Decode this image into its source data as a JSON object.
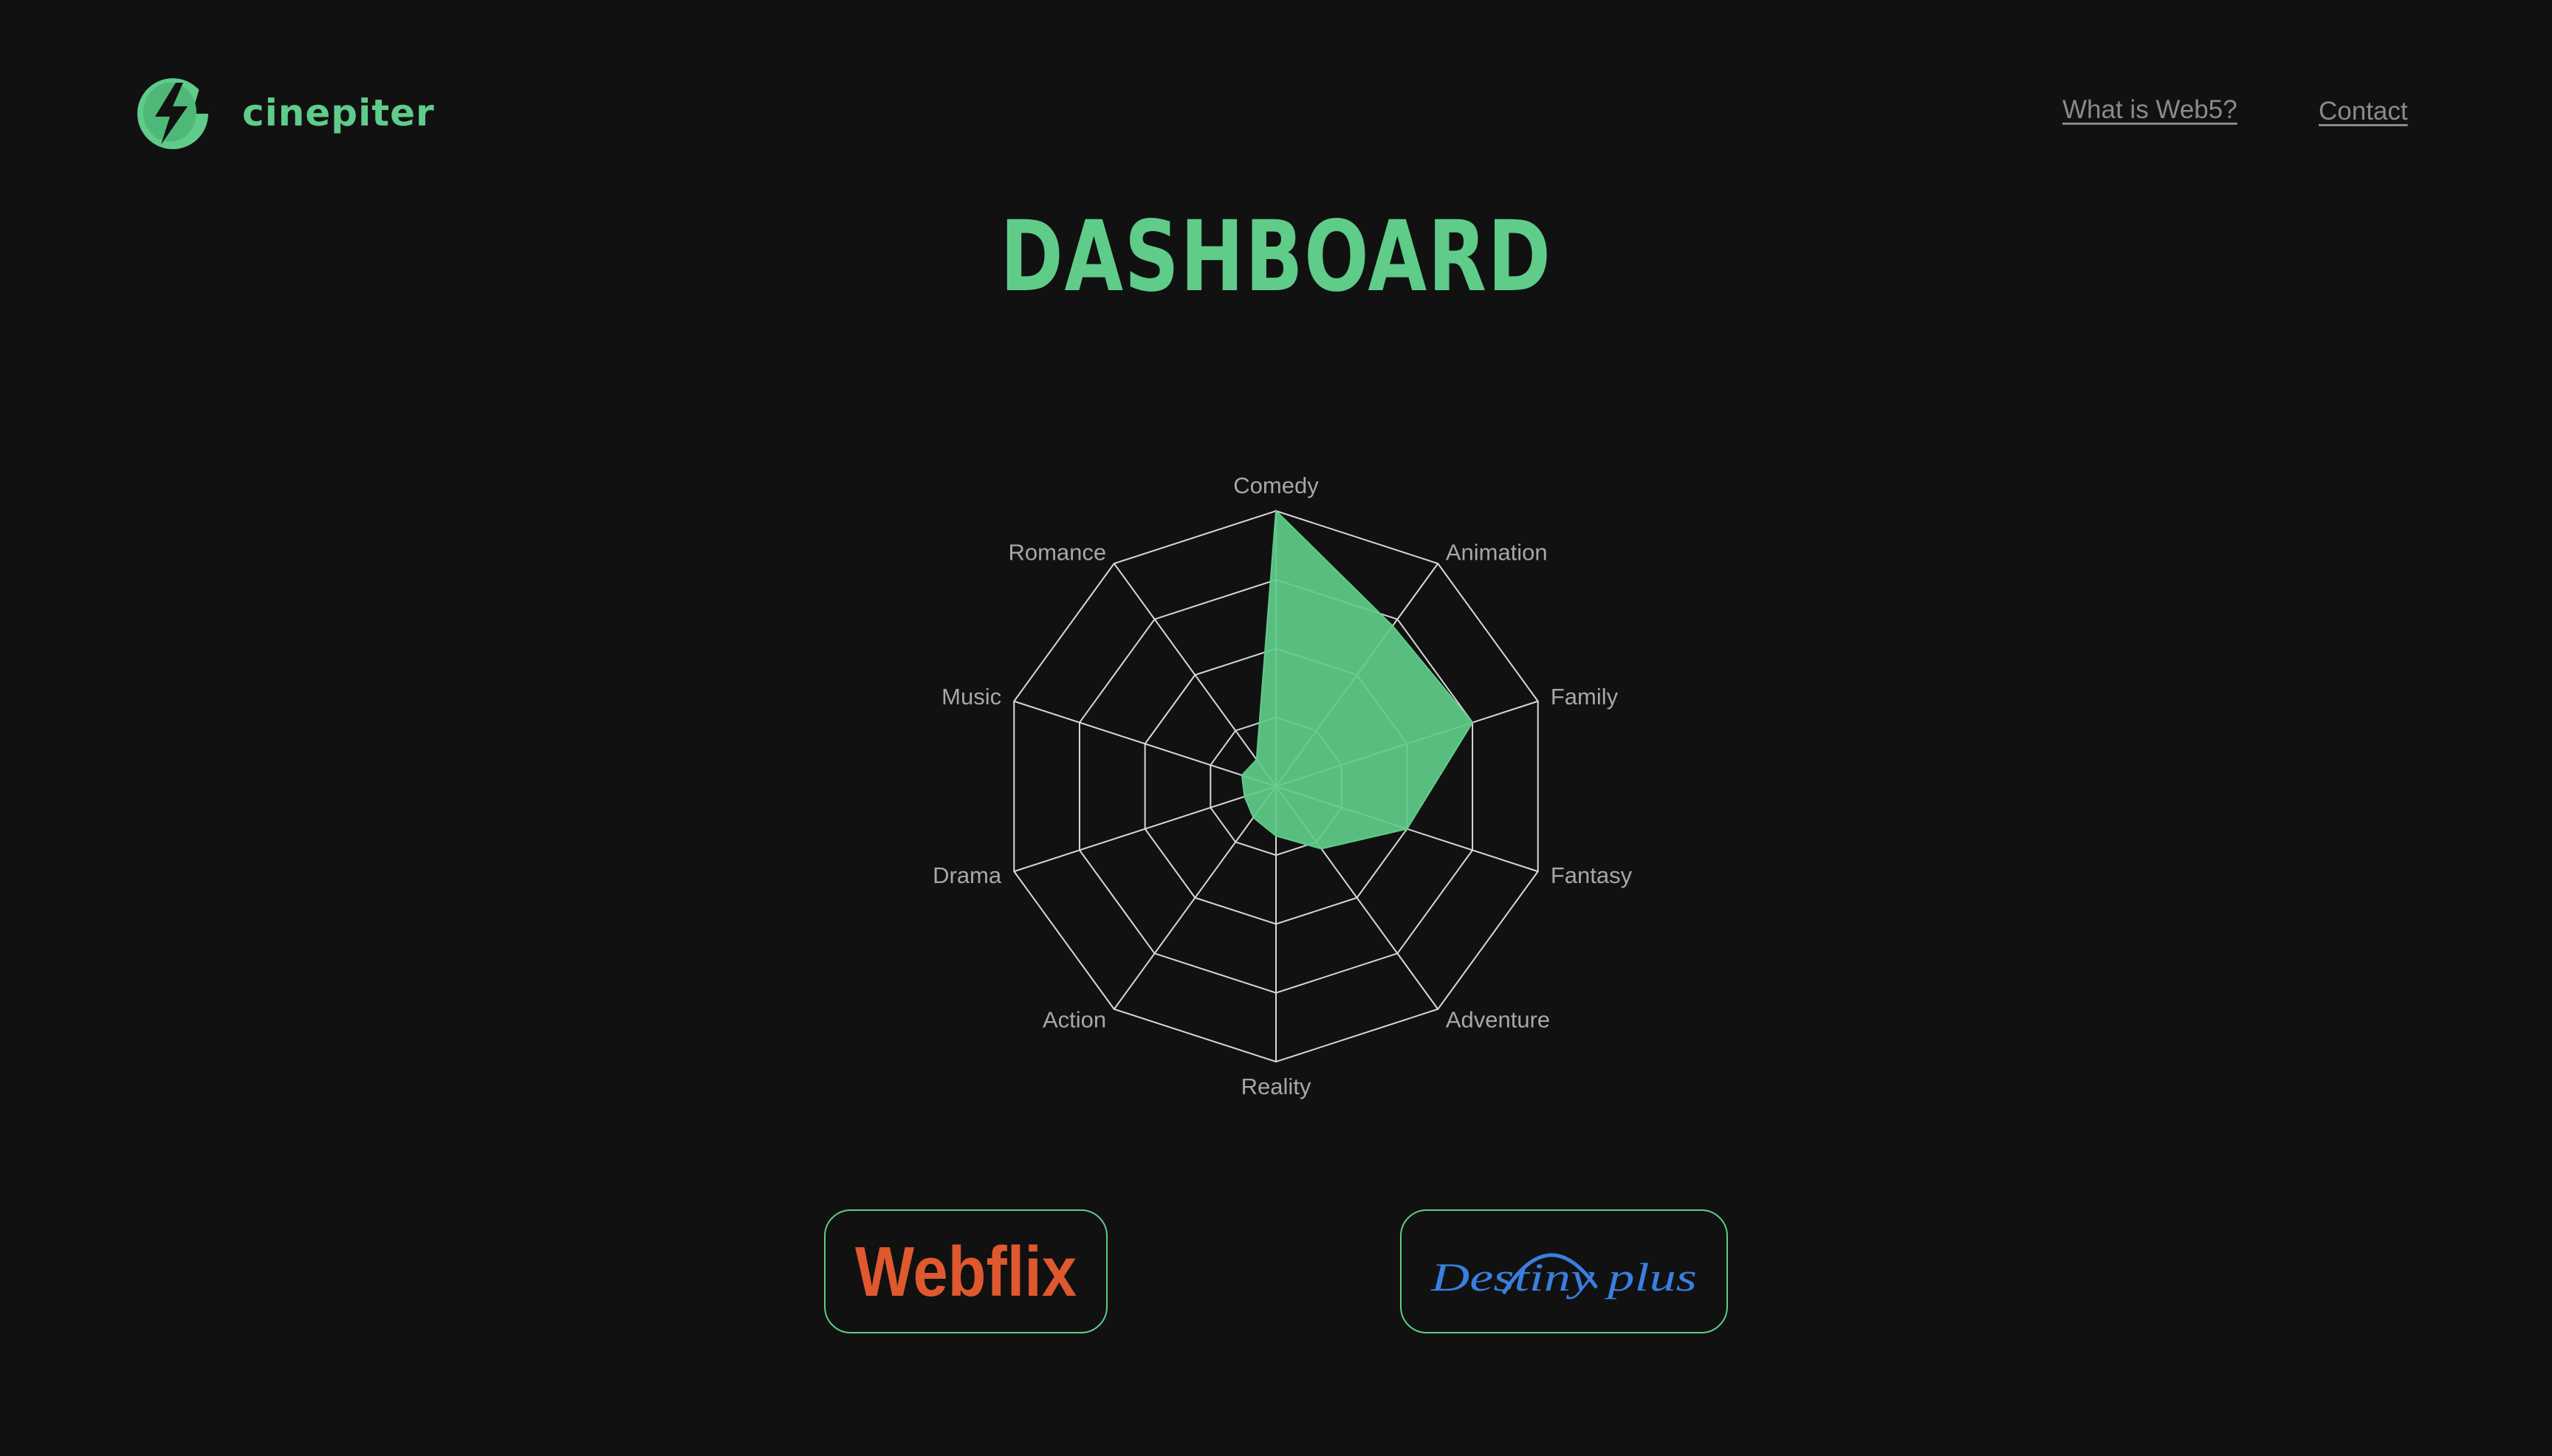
{
  "brand": {
    "name": "cinepiter",
    "icon": "lightning-bolt-icon",
    "accent_color": "#5fcc8a"
  },
  "nav": {
    "links": [
      "What is Web5?",
      "Contact"
    ]
  },
  "page_title": "DASHBOARD",
  "chart_data": {
    "type": "radar",
    "categories": [
      "Comedy",
      "Animation",
      "Family",
      "Fantasy",
      "Adventure",
      "Reality",
      "Action",
      "Drama",
      "Music",
      "Romance"
    ],
    "series": [
      {
        "values": [
          1.0,
          0.72,
          0.75,
          0.5,
          0.28,
          0.18,
          0.14,
          0.12,
          0.13,
          0.12
        ],
        "color": "#5fcc8a"
      }
    ],
    "rmax": 1.0,
    "rings": 4
  },
  "providers": [
    {
      "label": "Webflix",
      "color": "#e0582e"
    },
    {
      "label": "Destiny plus",
      "color": "#3a7fe0"
    }
  ]
}
